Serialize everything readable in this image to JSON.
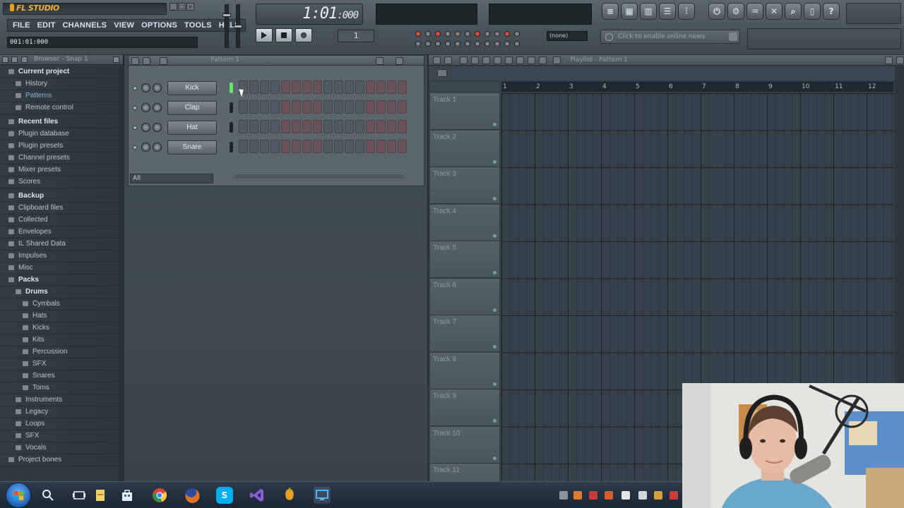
{
  "titlebar": {
    "app_name": "FL STUDIO"
  },
  "menu": {
    "items": [
      "FILE",
      "EDIT",
      "CHANNELS",
      "VIEW",
      "OPTIONS",
      "TOOLS",
      "HELP"
    ]
  },
  "hint_bar": {
    "value": "001:01:000"
  },
  "time_display": {
    "main": "1:01",
    "ms": ":000"
  },
  "pattern_counter": {
    "value": "1"
  },
  "snap_select": {
    "value": "(none)"
  },
  "news_bar": {
    "text": "Click to enable online news"
  },
  "browser": {
    "title": "Browser - Snap 1",
    "items": [
      {
        "label": "Current project",
        "indent": 0,
        "style": "bold"
      },
      {
        "label": "History",
        "indent": 1,
        "style": "normal"
      },
      {
        "label": "Patterns",
        "indent": 1,
        "style": "teal"
      },
      {
        "label": "Remote control",
        "indent": 1,
        "style": "normal"
      },
      {
        "label": "Recent files",
        "indent": 0,
        "style": "bold"
      },
      {
        "label": "Plugin database",
        "indent": 0,
        "style": "normal"
      },
      {
        "label": "Plugin presets",
        "indent": 0,
        "style": "normal"
      },
      {
        "label": "Channel presets",
        "indent": 0,
        "style": "normal"
      },
      {
        "label": "Mixer presets",
        "indent": 0,
        "style": "normal"
      },
      {
        "label": "Scores",
        "indent": 0,
        "style": "normal"
      },
      {
        "label": "Backup",
        "indent": 0,
        "style": "bold"
      },
      {
        "label": "Clipboard files",
        "indent": 0,
        "style": "normal"
      },
      {
        "label": "Collected",
        "indent": 0,
        "style": "normal"
      },
      {
        "label": "Envelopes",
        "indent": 0,
        "style": "normal"
      },
      {
        "label": "IL Shared Data",
        "indent": 0,
        "style": "normal"
      },
      {
        "label": "Impulses",
        "indent": 0,
        "style": "normal"
      },
      {
        "label": "Misc",
        "indent": 0,
        "style": "normal"
      },
      {
        "label": "Packs",
        "indent": 0,
        "style": "bold"
      },
      {
        "label": "Drums",
        "indent": 1,
        "style": "bold"
      },
      {
        "label": "Cymbals",
        "indent": 2,
        "style": "normal"
      },
      {
        "label": "Hats",
        "indent": 2,
        "style": "normal"
      },
      {
        "label": "Kicks",
        "indent": 2,
        "style": "normal"
      },
      {
        "label": "Kits",
        "indent": 2,
        "style": "normal"
      },
      {
        "label": "Percussion",
        "indent": 2,
        "style": "normal"
      },
      {
        "label": "SFX",
        "indent": 2,
        "style": "normal"
      },
      {
        "label": "Snares",
        "indent": 2,
        "style": "normal"
      },
      {
        "label": "Toms",
        "indent": 2,
        "style": "normal"
      },
      {
        "label": "Instruments",
        "indent": 1,
        "style": "normal"
      },
      {
        "label": "Legacy",
        "indent": 1,
        "style": "normal"
      },
      {
        "label": "Loops",
        "indent": 1,
        "style": "normal"
      },
      {
        "label": "SFX",
        "indent": 1,
        "style": "normal"
      },
      {
        "label": "Vocals",
        "indent": 1,
        "style": "normal"
      },
      {
        "label": "Project bones",
        "indent": 0,
        "style": "normal"
      }
    ]
  },
  "step_sequencer": {
    "title": "Pattern 1",
    "filter": "All",
    "channels": [
      {
        "name": "Kick",
        "selected": true
      },
      {
        "name": "Clap",
        "selected": false
      },
      {
        "name": "Hat",
        "selected": false
      },
      {
        "name": "Snare",
        "selected": false
      }
    ]
  },
  "playlist": {
    "title": "Playlist - Pattern 1",
    "tracks": [
      "Track 1",
      "Track 2",
      "Track 3",
      "Track 4",
      "Track 5",
      "Track 6",
      "Track 7",
      "Track 8",
      "Track 9",
      "Track 10",
      "Track 11"
    ],
    "bars": [
      "1",
      "2",
      "3",
      "4",
      "5",
      "6",
      "7",
      "8",
      "9",
      "10",
      "11",
      "12"
    ]
  },
  "taskbar": {
    "pinned": [
      "start-orb",
      "search-icon",
      "task-view-icon",
      "file-explorer-icon",
      "store-icon",
      "chrome-icon",
      "firefox-icon",
      "skype-icon",
      "visual-studio-icon",
      "fl-studio-icon",
      "monitor-icon"
    ]
  },
  "colors": {
    "accent_red": "#e04a3a",
    "selected_green": "#6de06d",
    "logo_orange": "#f0b030"
  }
}
